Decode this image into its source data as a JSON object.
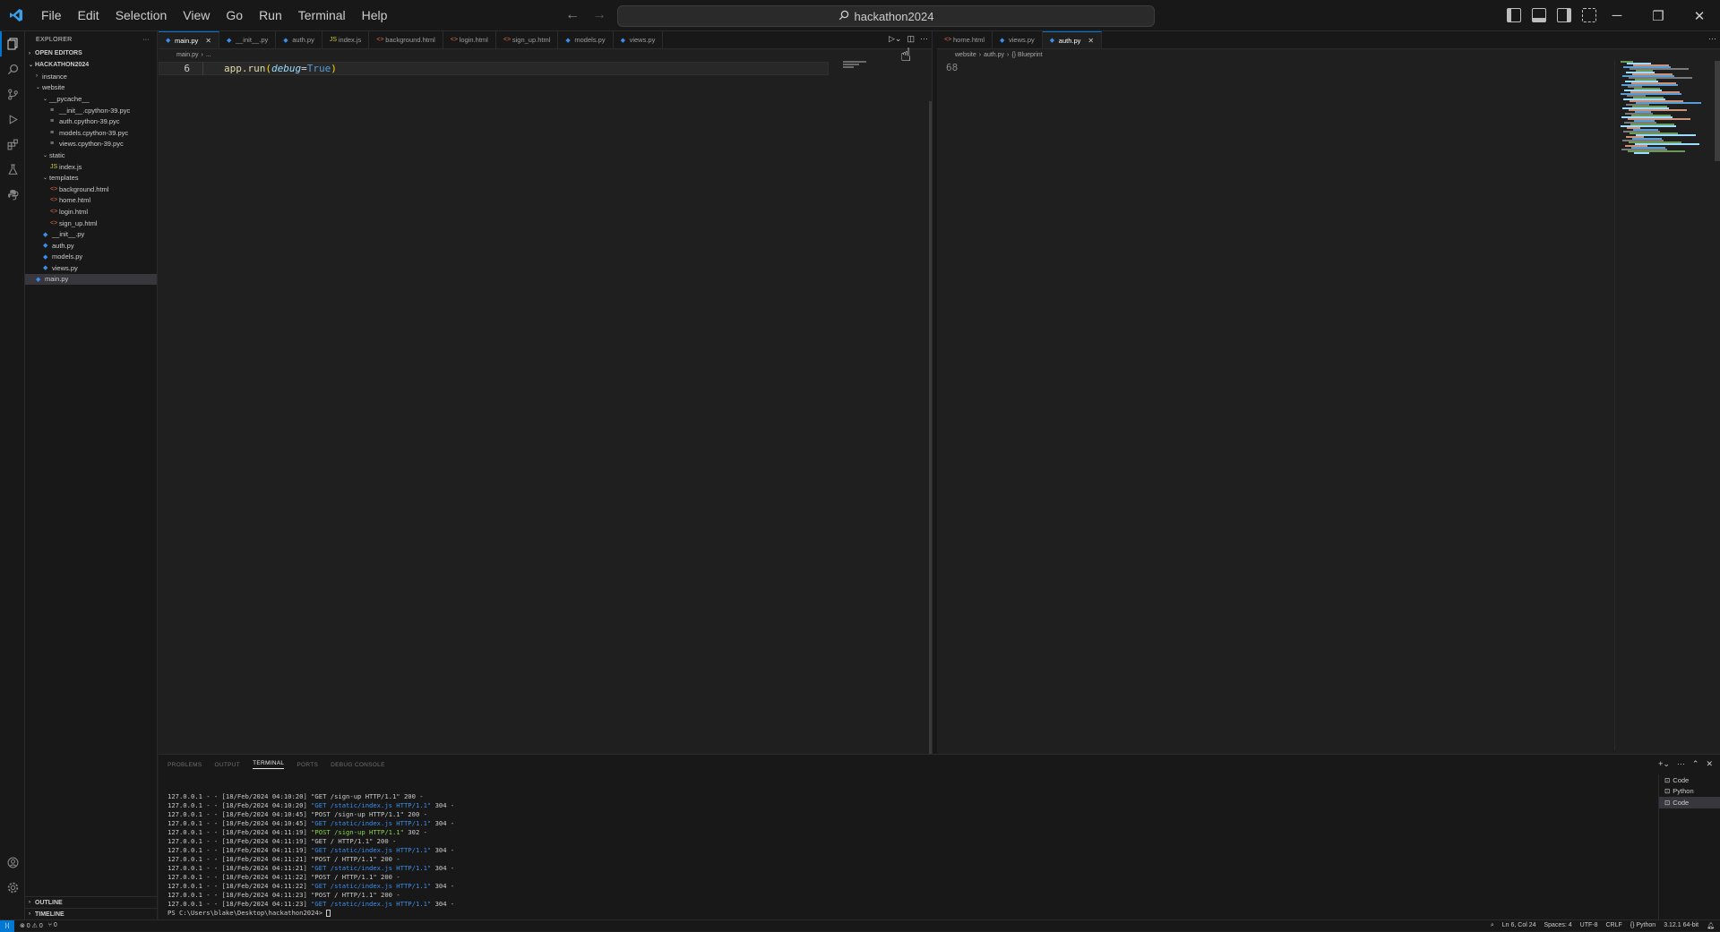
{
  "menu": [
    "File",
    "Edit",
    "Selection",
    "View",
    "Go",
    "Run",
    "Terminal",
    "Help"
  ],
  "search": {
    "text": "hackathon2024"
  },
  "explorer": {
    "title": "EXPLORER",
    "open_editors": "OPEN EDITORS",
    "root": "HACKATHON2024",
    "tree": [
      {
        "label": "instance",
        "depth": 1,
        "kind": "folder",
        "expanded": false
      },
      {
        "label": "website",
        "depth": 1,
        "kind": "folder",
        "expanded": true
      },
      {
        "label": "__pycache__",
        "depth": 2,
        "kind": "folder",
        "expanded": true
      },
      {
        "label": "__init__.cpython-39.pyc",
        "depth": 3,
        "kind": "pyc"
      },
      {
        "label": "auth.cpython-39.pyc",
        "depth": 3,
        "kind": "pyc"
      },
      {
        "label": "models.cpython-39.pyc",
        "depth": 3,
        "kind": "pyc"
      },
      {
        "label": "views.cpython-39.pyc",
        "depth": 3,
        "kind": "pyc"
      },
      {
        "label": "static",
        "depth": 2,
        "kind": "folder",
        "expanded": true
      },
      {
        "label": "index.js",
        "depth": 3,
        "kind": "js"
      },
      {
        "label": "templates",
        "depth": 2,
        "kind": "folder",
        "expanded": true
      },
      {
        "label": "background.html",
        "depth": 3,
        "kind": "html"
      },
      {
        "label": "home.html",
        "depth": 3,
        "kind": "html"
      },
      {
        "label": "login.html",
        "depth": 3,
        "kind": "html"
      },
      {
        "label": "sign_up.html",
        "depth": 3,
        "kind": "html"
      },
      {
        "label": "__init__.py",
        "depth": 2,
        "kind": "py"
      },
      {
        "label": "auth.py",
        "depth": 2,
        "kind": "py"
      },
      {
        "label": "models.py",
        "depth": 2,
        "kind": "py"
      },
      {
        "label": "views.py",
        "depth": 2,
        "kind": "py"
      },
      {
        "label": "main.py",
        "depth": 1,
        "kind": "py",
        "selected": true
      }
    ],
    "outline": "OUTLINE",
    "timeline": "TIMELINE"
  },
  "left_editor": {
    "tabs": [
      {
        "label": "main.py",
        "kind": "py",
        "active": true
      },
      {
        "label": "__init__.py",
        "kind": "py"
      },
      {
        "label": "auth.py",
        "kind": "py"
      },
      {
        "label": "index.js",
        "kind": "js"
      },
      {
        "label": "background.html",
        "kind": "html"
      },
      {
        "label": "login.html",
        "kind": "html"
      },
      {
        "label": "sign_up.html",
        "kind": "html"
      },
      {
        "label": "models.py",
        "kind": "py"
      },
      {
        "label": "views.py",
        "kind": "py"
      }
    ],
    "breadcrumb": [
      "main.py",
      "..."
    ],
    "line_number": "6",
    "code": {
      "fn": "app.run",
      "param": "debug",
      "op": "=",
      "value": "True"
    }
  },
  "right_editor": {
    "tabs": [
      {
        "label": "home.html",
        "kind": "html"
      },
      {
        "label": "views.py",
        "kind": "py"
      },
      {
        "label": "auth.py",
        "kind": "py",
        "active": true
      }
    ],
    "breadcrumb": [
      "website",
      "auth.py",
      "{} Blueprint"
    ],
    "line_number": "68"
  },
  "panel": {
    "tabs": [
      "PROBLEMS",
      "OUTPUT",
      "TERMINAL",
      "PORTS",
      "DEBUG CONSOLE"
    ],
    "active_tab": "TERMINAL",
    "terminal_lines": [
      {
        "prefix": "127.0.0.1 - - [18/Feb/2024 04:10:20] ",
        "req": "\"GET /sign-up HTTP/1.1\"",
        "suffix": " 200 -",
        "style": "plain"
      },
      {
        "prefix": "127.0.0.1 - - [18/Feb/2024 04:10:20] ",
        "req": "\"GET /static/index.js HTTP/1.1\"",
        "suffix": " 304 -",
        "style": "url"
      },
      {
        "prefix": "127.0.0.1 - - [18/Feb/2024 04:10:45] ",
        "req": "\"POST /sign-up HTTP/1.1\"",
        "suffix": " 200 -",
        "style": "plain"
      },
      {
        "prefix": "127.0.0.1 - - [18/Feb/2024 04:10:45] ",
        "req": "\"GET /static/index.js HTTP/1.1\"",
        "suffix": " 304 -",
        "style": "url"
      },
      {
        "prefix": "127.0.0.1 - - [18/Feb/2024 04:11:19] ",
        "req": "\"POST /sign-up HTTP/1.1\"",
        "suffix": " 302 -",
        "style": "post"
      },
      {
        "prefix": "127.0.0.1 - - [18/Feb/2024 04:11:19] ",
        "req": "\"GET / HTTP/1.1\"",
        "suffix": " 200 -",
        "style": "plain"
      },
      {
        "prefix": "127.0.0.1 - - [18/Feb/2024 04:11:19] ",
        "req": "\"GET /static/index.js HTTP/1.1\"",
        "suffix": " 304 -",
        "style": "url"
      },
      {
        "prefix": "127.0.0.1 - - [18/Feb/2024 04:11:21] ",
        "req": "\"POST / HTTP/1.1\"",
        "suffix": " 200 -",
        "style": "plain"
      },
      {
        "prefix": "127.0.0.1 - - [18/Feb/2024 04:11:21] ",
        "req": "\"GET /static/index.js HTTP/1.1\"",
        "suffix": " 304 -",
        "style": "url"
      },
      {
        "prefix": "127.0.0.1 - - [18/Feb/2024 04:11:22] ",
        "req": "\"POST / HTTP/1.1\"",
        "suffix": " 200 -",
        "style": "plain"
      },
      {
        "prefix": "127.0.0.1 - - [18/Feb/2024 04:11:22] ",
        "req": "\"GET /static/index.js HTTP/1.1\"",
        "suffix": " 304 -",
        "style": "url"
      },
      {
        "prefix": "127.0.0.1 - - [18/Feb/2024 04:11:23] ",
        "req": "\"POST / HTTP/1.1\"",
        "suffix": " 200 -",
        "style": "plain"
      },
      {
        "prefix": "127.0.0.1 - - [18/Feb/2024 04:11:23] ",
        "req": "\"GET /static/index.js HTTP/1.1\"",
        "suffix": " 304 -",
        "style": "url"
      }
    ],
    "prompt": "PS C:\\Users\\blake\\Desktop\\hackathon2024> ",
    "terminals": [
      {
        "label": "Code"
      },
      {
        "label": "Python"
      },
      {
        "label": "Code",
        "selected": true
      }
    ]
  },
  "status": {
    "problems": "⊗ 0 ⚠ 0",
    "ports": "⑂ 0",
    "position": "Ln 6, Col 24",
    "spaces": "Spaces: 4",
    "encoding": "UTF-8",
    "eol": "CRLF",
    "language": "{} Python",
    "interpreter": "3.12.1 64-bit"
  },
  "colors": {
    "accent": "#0078d4",
    "bg": "#1f1f1f",
    "sidebar": "#181818"
  }
}
